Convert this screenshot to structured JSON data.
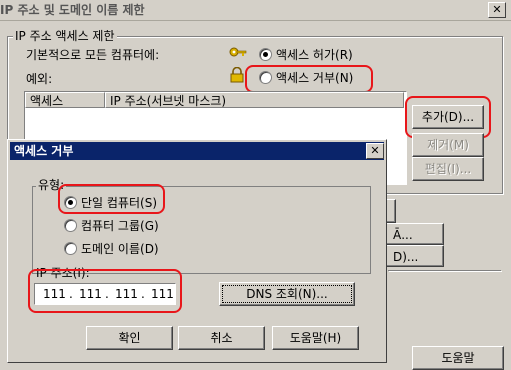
{
  "window": {
    "title": "IP 주소 및 도메인 이름 제한",
    "close_glyph": "✕"
  },
  "group": {
    "legend": "IP 주소 액세스 제한",
    "default_label": "기본적으로 모든 컴퓨터에:",
    "grant_label": "액세스 허가(R)",
    "deny_label": "액세스 거부(N)",
    "except_label": "예외:",
    "columns": [
      "액세스",
      "IP 주소(서브넷 마스크)"
    ]
  },
  "side_buttons": {
    "add": "추가(D)...",
    "remove": "제거(M)",
    "edit": "편집(I)..."
  },
  "bg_fragments": {
    "frag1": "Ᾱ...",
    "frag2": "D)...",
    "help_bottom": "도움말"
  },
  "dialog": {
    "title": "액세스 거부",
    "close_glyph": "✕",
    "type_legend": "유형:",
    "options": [
      "단일 컴퓨터(S)",
      "컴퓨터 그룹(G)",
      "도메인 이름(D)"
    ],
    "selected_option": 0,
    "ip_label": "IP 주소(I):",
    "ip_octets": [
      "111",
      "111",
      "111",
      "111"
    ],
    "dns_button": "DNS 조회(N)...",
    "ok": "확인",
    "cancel": "취소",
    "help": "도움말(H)"
  },
  "colors": {
    "face": "#d4d0c8",
    "title_active": "#0a246a",
    "highlight": "#e8161a"
  }
}
